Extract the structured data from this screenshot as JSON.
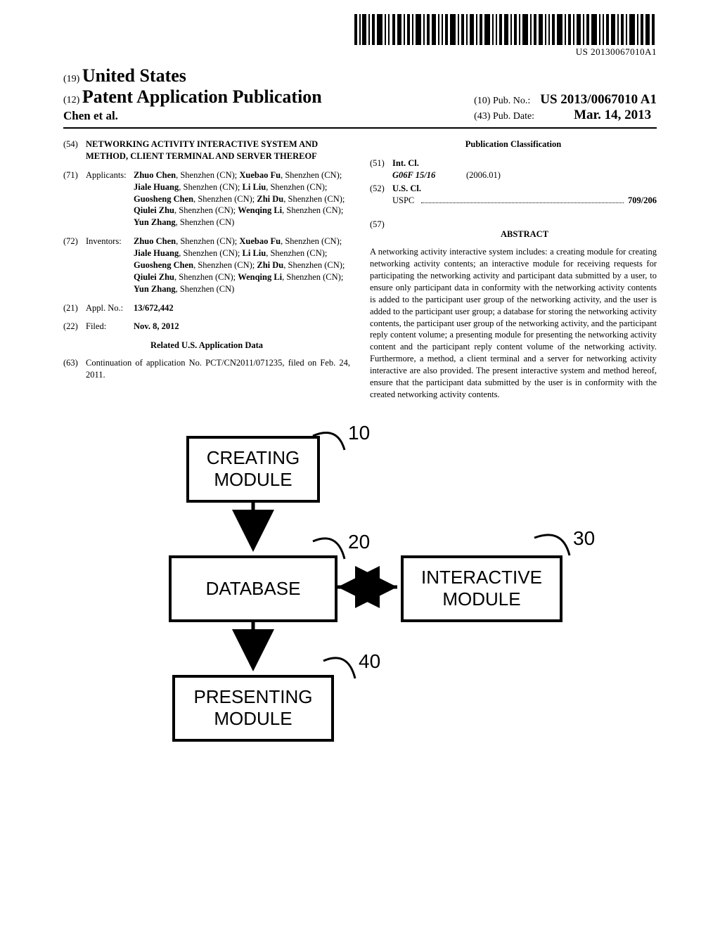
{
  "barcode_text": "US 20130067010A1",
  "header": {
    "country_code": "(19)",
    "country": "United States",
    "pub_type_code": "(12)",
    "pub_type": "Patent Application Publication",
    "author_line": "Chen et al.",
    "pubno_code": "(10)",
    "pubno_label": "Pub. No.:",
    "pubno": "US 2013/0067010 A1",
    "pubdate_code": "(43)",
    "pubdate_label": "Pub. Date:",
    "pubdate": "Mar. 14, 2013"
  },
  "left": {
    "title_code": "(54)",
    "title": "NETWORKING ACTIVITY INTERACTIVE SYSTEM AND METHOD, CLIENT TERMINAL AND SERVER THEREOF",
    "applicants_code": "(71)",
    "applicants_label": "Applicants:",
    "applicants_html": "<span class='bold'>Zhuo Chen</span>, Shenzhen (CN); <span class='bold'>Xuebao Fu</span>, Shenzhen (CN); <span class='bold'>Jiale Huang</span>, Shenzhen (CN); <span class='bold'>Li Liu</span>, Shenzhen (CN); <span class='bold'>Guosheng Chen</span>, Shenzhen (CN); <span class='bold'>Zhi Du</span>, Shenzhen (CN); <span class='bold'>Qiulei Zhu</span>, Shenzhen (CN); <span class='bold'>Wenqing Li</span>, Shenzhen (CN); <span class='bold'>Yun Zhang</span>, Shenzhen (CN)",
    "inventors_code": "(72)",
    "inventors_label": "Inventors:",
    "inventors_html": "<span class='bold'>Zhuo Chen</span>, Shenzhen (CN); <span class='bold'>Xuebao Fu</span>, Shenzhen (CN); <span class='bold'>Jiale Huang</span>, Shenzhen (CN); <span class='bold'>Li Liu</span>, Shenzhen (CN); <span class='bold'>Guosheng Chen</span>, Shenzhen (CN); <span class='bold'>Zhi Du</span>, Shenzhen (CN); <span class='bold'>Qiulei Zhu</span>, Shenzhen (CN); <span class='bold'>Wenqing Li</span>, Shenzhen (CN); <span class='bold'>Yun Zhang</span>, Shenzhen (CN)",
    "applno_code": "(21)",
    "applno_label": "Appl. No.:",
    "applno": "13/672,442",
    "filed_code": "(22)",
    "filed_label": "Filed:",
    "filed": "Nov. 8, 2012",
    "related_heading": "Related U.S. Application Data",
    "continuation_code": "(63)",
    "continuation": "Continuation of application No. PCT/CN2011/071235, filed on Feb. 24, 2011."
  },
  "right": {
    "classif_heading": "Publication Classification",
    "intcl_code": "(51)",
    "intcl_label": "Int. Cl.",
    "intcl_class": "G06F 15/16",
    "intcl_date": "(2006.01)",
    "uscl_code": "(52)",
    "uscl_label": "U.S. Cl.",
    "uspc_label": "USPC",
    "uspc_val": "709/206",
    "abstract_code": "(57)",
    "abstract_heading": "ABSTRACT",
    "abstract": "A networking activity interactive system includes: a creating module for creating networking activity contents; an interactive module for receiving requests for participating the networking activity and participant data submitted by a user, to ensure only participant data in conformity with the networking activity contents is added to the participant user group of the networking activity, and the user is added to the participant user group; a database for storing the networking activity contents, the participant user group of the networking activity, and the participant reply content volume; a presenting module for presenting the networking activity content and the participant reply content volume of the networking activity. Furthermore, a method, a client terminal and a server for networking activity interactive are also provided. The present interactive system and method hereof, ensure that the participant data submitted by the user is in conformity with the created networking activity contents."
  },
  "diagram": {
    "boxes": {
      "creating": "CREATING\nMODULE",
      "database": "DATABASE",
      "interactive": "INTERACTIVE\nMODULE",
      "presenting": "PRESENTING\nMODULE"
    },
    "labels": {
      "creating": "10",
      "database": "20",
      "interactive": "30",
      "presenting": "40"
    }
  }
}
